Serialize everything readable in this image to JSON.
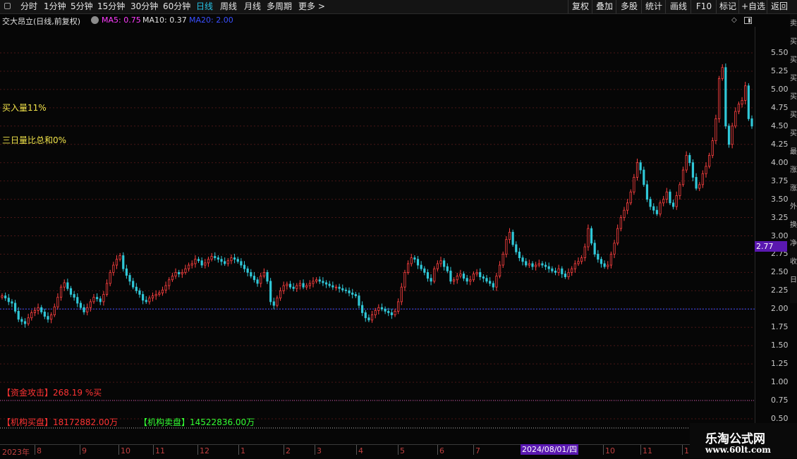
{
  "toolbar": {
    "periods": [
      "分时",
      "1分钟",
      "5分钟",
      "15分钟",
      "30分钟",
      "60分钟",
      "日线",
      "周线",
      "月线",
      "多周期",
      "更多 >"
    ],
    "active": "日线",
    "actions": [
      "复权",
      "叠加",
      "多股",
      "统计",
      "画线",
      "F10",
      "标记",
      "+自选",
      "返回"
    ]
  },
  "title": {
    "stock": "交大昂立(日线,前复权)",
    "ma5": "MA5: 0.75",
    "ma10": "MA10: 0.37",
    "ma20": "MA20: 2.00"
  },
  "indicators": {
    "buy_ratio": "买入量11%",
    "three_day": "三日量比总和0%",
    "fund_attack_label": "【资金攻击】",
    "fund_attack_value": "268.19 %买",
    "inst_buy_label": "【机构买盘】",
    "inst_buy_value": "18172882.00万",
    "inst_sell_label": "【机构卖盘】",
    "inst_sell_value": "14522836.00万"
  },
  "price_axis": {
    "ticks": [
      "5.50",
      "5.25",
      "5.00",
      "4.75",
      "4.50",
      "4.25",
      "4.00",
      "3.75",
      "3.50",
      "3.25",
      "3.00",
      "2.75",
      "2.50",
      "2.25",
      "2.00",
      "1.75",
      "1.50",
      "1.25",
      "1.00",
      "0.75",
      "0.50"
    ],
    "current_price": "2.77"
  },
  "date_axis": {
    "labels": [
      "2023年",
      "8",
      "9",
      "10",
      "11",
      "12",
      "1",
      "2",
      "3",
      "4",
      "5",
      "6",
      "7",
      "10",
      "11",
      "1"
    ],
    "cursor_date": "2024/08/01/四"
  },
  "sidebar_chars": [
    "卖",
    "买",
    "买",
    "买",
    "买",
    "买",
    "买",
    "最",
    "涨",
    "涨",
    "外",
    "换",
    "净",
    "收",
    "日"
  ],
  "watermark": {
    "line1": "乐淘公式网",
    "line2": "www.60lt.com"
  },
  "colors": {
    "up": "#ff4040",
    "down": "#30c8d8",
    "ma20": "#3a4fff",
    "grid": "#4a1616"
  },
  "chart_data": {
    "type": "candlestick",
    "period": "daily",
    "ylim": [
      0.5,
      5.6
    ],
    "grid": true,
    "closes": [
      2.18,
      2.15,
      2.1,
      2.08,
      1.97,
      1.86,
      1.83,
      1.8,
      1.88,
      1.95,
      1.98,
      2.02,
      1.96,
      1.9,
      1.86,
      1.92,
      2.03,
      2.16,
      2.3,
      2.36,
      2.28,
      2.2,
      2.16,
      2.08,
      2.02,
      1.96,
      2.02,
      2.1,
      2.16,
      2.14,
      2.1,
      2.2,
      2.35,
      2.5,
      2.6,
      2.68,
      2.73,
      2.55,
      2.46,
      2.38,
      2.3,
      2.25,
      2.2,
      2.12,
      2.1,
      2.15,
      2.18,
      2.2,
      2.22,
      2.26,
      2.32,
      2.4,
      2.45,
      2.5,
      2.48,
      2.5,
      2.55,
      2.6,
      2.62,
      2.68,
      2.66,
      2.6,
      2.63,
      2.68,
      2.72,
      2.7,
      2.68,
      2.65,
      2.62,
      2.66,
      2.7,
      2.68,
      2.65,
      2.6,
      2.55,
      2.5,
      2.45,
      2.4,
      2.35,
      2.45,
      2.5,
      2.38,
      2.1,
      2.05,
      2.15,
      2.25,
      2.32,
      2.34,
      2.3,
      2.28,
      2.32,
      2.35,
      2.3,
      2.32,
      2.35,
      2.38,
      2.4,
      2.38,
      2.36,
      2.34,
      2.32,
      2.3,
      2.3,
      2.28,
      2.26,
      2.25,
      2.22,
      2.2,
      2.18,
      2.05,
      1.95,
      1.88,
      1.85,
      1.92,
      1.98,
      2.02,
      2.0,
      1.97,
      1.95,
      1.92,
      1.97,
      2.1,
      2.3,
      2.5,
      2.62,
      2.7,
      2.68,
      2.6,
      2.55,
      2.5,
      2.42,
      2.38,
      2.55,
      2.62,
      2.66,
      2.58,
      2.52,
      2.38,
      2.4,
      2.45,
      2.48,
      2.42,
      2.38,
      2.4,
      2.48,
      2.5,
      2.44,
      2.42,
      2.38,
      2.35,
      2.3,
      2.45,
      2.6,
      2.75,
      2.95,
      3.05,
      2.88,
      2.78,
      2.7,
      2.65,
      2.6,
      2.62,
      2.58,
      2.6,
      2.62,
      2.6,
      2.58,
      2.55,
      2.52,
      2.5,
      2.55,
      2.48,
      2.44,
      2.5,
      2.55,
      2.62,
      2.65,
      2.7,
      2.85,
      3.1,
      2.9,
      2.75,
      2.68,
      2.62,
      2.58,
      2.6,
      2.75,
      2.9,
      3.1,
      3.25,
      3.35,
      3.45,
      3.6,
      3.8,
      4.0,
      3.9,
      3.7,
      3.5,
      3.4,
      3.35,
      3.3,
      3.45,
      3.5,
      3.6,
      3.45,
      3.4,
      3.55,
      3.7,
      3.9,
      4.1,
      4.0,
      3.8,
      3.65,
      3.7,
      3.85,
      3.95,
      4.1,
      4.3,
      4.6,
      5.15,
      5.3,
      4.5,
      4.25,
      4.5,
      4.7,
      4.8,
      4.85,
      5.05,
      4.6,
      4.5
    ]
  }
}
